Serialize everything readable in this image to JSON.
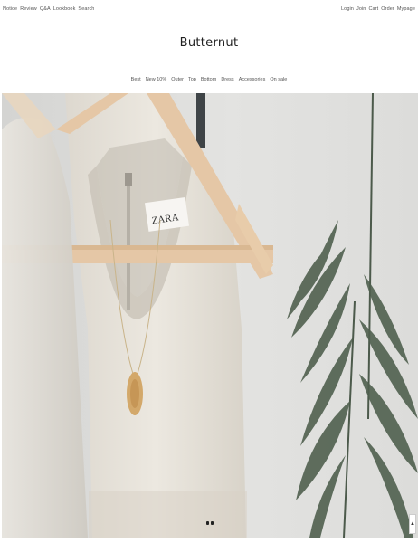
{
  "top_left_links": [
    "Notice",
    "Review",
    "Q&A",
    "Lookbook",
    "Search"
  ],
  "top_right_links": [
    "Login",
    "Join",
    "Cart",
    "Order",
    "Mypage"
  ],
  "brand": {
    "name": "Butternut"
  },
  "categories": [
    "Best",
    "New 10%",
    "Outer",
    "Top",
    "Bottom",
    "Dress",
    "Accessories",
    "On sale"
  ],
  "hero": {
    "tag_text": "ZARA"
  },
  "scroll_top": {
    "icon": "arrow-up-icon",
    "glyph": "▲"
  },
  "slider": {
    "total": 2,
    "active": 1
  }
}
